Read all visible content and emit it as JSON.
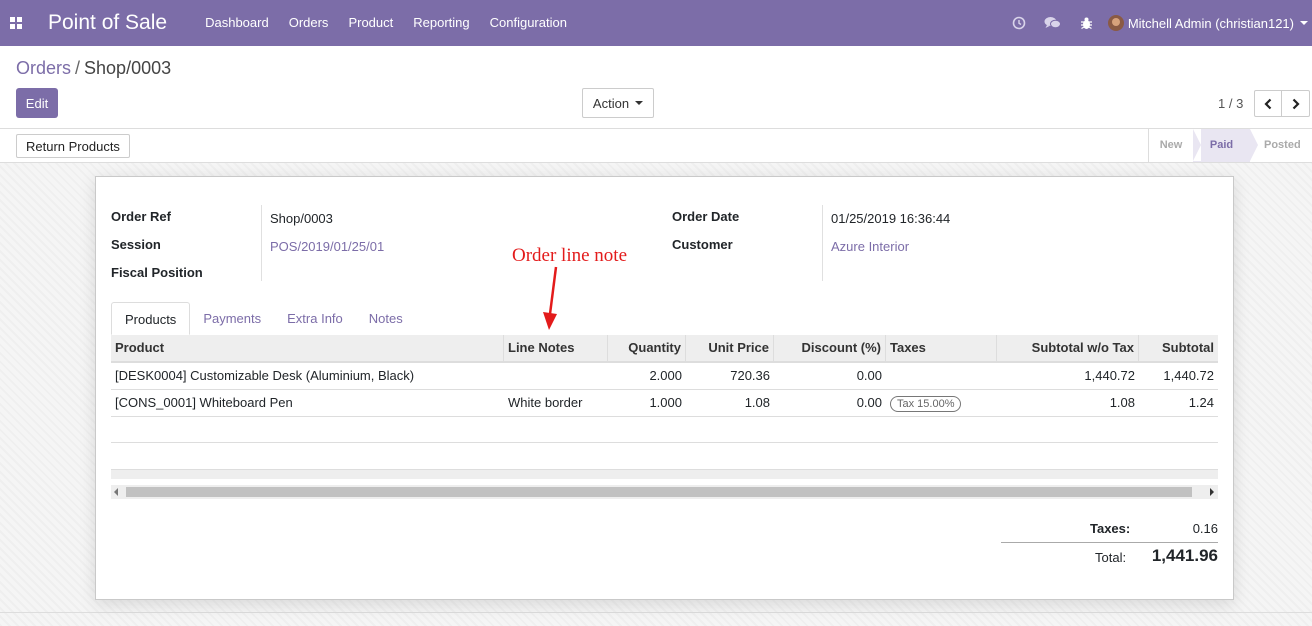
{
  "navbar": {
    "app_title": "Point of Sale",
    "menu": [
      "Dashboard",
      "Orders",
      "Product",
      "Reporting",
      "Configuration"
    ],
    "icons": [
      "clock-icon",
      "chat-icon",
      "bug-icon"
    ],
    "user": "Mitchell Admin (christian121)",
    "color": "#7c6da8"
  },
  "breadcrumb": {
    "parent": "Orders",
    "current": "Shop/0003"
  },
  "buttons": {
    "edit": "Edit",
    "action": "Action",
    "return_products": "Return Products"
  },
  "pager": {
    "value": "1 / 3"
  },
  "statusbar": {
    "stages": [
      "New",
      "Paid",
      "Posted"
    ],
    "active": "Paid"
  },
  "form": {
    "order_ref_label": "Order Ref",
    "order_ref": "Shop/0003",
    "session_label": "Session",
    "session": "POS/2019/01/25/01",
    "fiscal_position_label": "Fiscal Position",
    "fiscal_position": "",
    "order_date_label": "Order Date",
    "order_date": "01/25/2019 16:36:44",
    "customer_label": "Customer",
    "customer": "Azure Interior"
  },
  "annotation": "Order line note",
  "tabs": [
    "Products",
    "Payments",
    "Extra Info",
    "Notes"
  ],
  "table": {
    "headers": [
      "Product",
      "Line Notes",
      "Quantity",
      "Unit Price",
      "Discount (%)",
      "Taxes",
      "Subtotal w/o Tax",
      "Subtotal"
    ],
    "rows": [
      {
        "product": "[DESK0004] Customizable Desk (Aluminium, Black)",
        "line_notes": "",
        "quantity": "2.000",
        "unit_price": "720.36",
        "discount": "0.00",
        "taxes": "",
        "subtotal_wo_tax": "1,440.72",
        "subtotal": "1,440.72"
      },
      {
        "product": "[CONS_0001] Whiteboard Pen",
        "line_notes": "White border",
        "quantity": "1.000",
        "unit_price": "1.08",
        "discount": "0.00",
        "taxes": "Tax 15.00%",
        "subtotal_wo_tax": "1.08",
        "subtotal": "1.24"
      }
    ]
  },
  "totals": {
    "taxes_label": "Taxes:",
    "taxes": "0.16",
    "total_label": "Total:",
    "total": "1,441.96"
  }
}
